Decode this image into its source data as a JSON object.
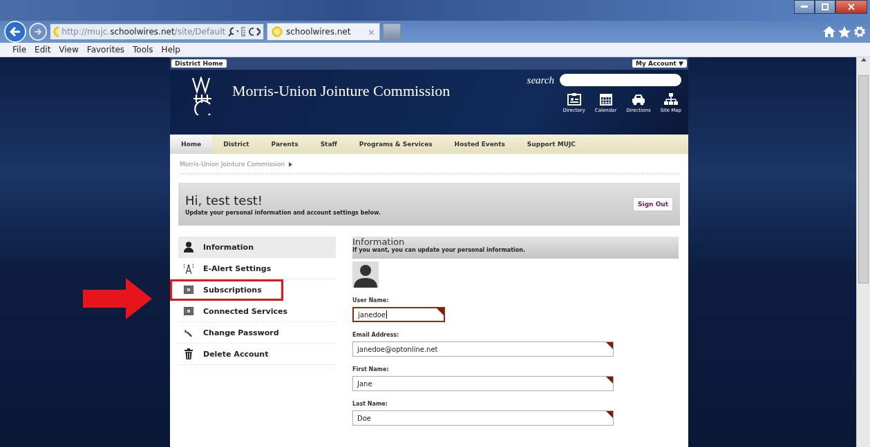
{
  "browser": {
    "url": "http://mujc.**schoolwires.net**/site/Default",
    "tab": {
      "title": "schoolwires.net",
      "close": "×"
    },
    "menu": [
      "File",
      "Edit",
      "View",
      "Favorites",
      "Tools",
      "Help"
    ]
  },
  "topbar": {
    "left": "District Home",
    "right": "My Account",
    "right_caret": "▼"
  },
  "header": {
    "title": "Morris-Union Jointure Commission",
    "search_label": "search",
    "links": [
      {
        "kind": "directory",
        "label": "Directory"
      },
      {
        "kind": "calendar",
        "label": "Calendar"
      },
      {
        "kind": "directions",
        "label": "Directions"
      },
      {
        "kind": "sitemap",
        "label": "Site Map"
      }
    ]
  },
  "nav": [
    {
      "label": "Home",
      "selected": true
    },
    {
      "label": "District",
      "selected": false
    },
    {
      "label": "Parents",
      "selected": false
    },
    {
      "label": "Staff",
      "selected": false
    },
    {
      "label": "Programs & Services",
      "selected": false
    },
    {
      "label": "Hosted Events",
      "selected": false
    },
    {
      "label": "Support MUJC",
      "selected": false
    }
  ],
  "breadcrumb": "Morris-Union Jointure Commission",
  "greeting": {
    "title": "Hi, test test!",
    "subtitle": "Update your personal information and account settings below.",
    "button": "Sign Out"
  },
  "account_menu": [
    {
      "kind": "person",
      "label": "Information",
      "selected": true,
      "highlighted": false
    },
    {
      "kind": "antenna",
      "label": "E-Alert Settings",
      "selected": false,
      "highlighted": false
    },
    {
      "kind": "panel",
      "label": "Subscriptions",
      "selected": false,
      "highlighted": true
    },
    {
      "kind": "panel",
      "label": "Connected Services",
      "selected": false,
      "highlighted": false
    },
    {
      "kind": "wrench",
      "label": "Change Password",
      "selected": false,
      "highlighted": false
    },
    {
      "kind": "trash",
      "label": "Delete Account",
      "selected": false,
      "highlighted": false
    }
  ],
  "form": {
    "title": "Information",
    "subtitle": "If you want, you can update your personal information.",
    "fields": [
      {
        "label": "User Name:",
        "value": "janedoe",
        "focused": true,
        "wide": false
      },
      {
        "label": "Email Address:",
        "value": "janedoe@optonline.net",
        "focused": false,
        "wide": true
      },
      {
        "label": "First Name:",
        "value": "Jane",
        "focused": false,
        "wide": true
      },
      {
        "label": "Last Name:",
        "value": "Doe",
        "focused": false,
        "wide": true
      }
    ]
  }
}
